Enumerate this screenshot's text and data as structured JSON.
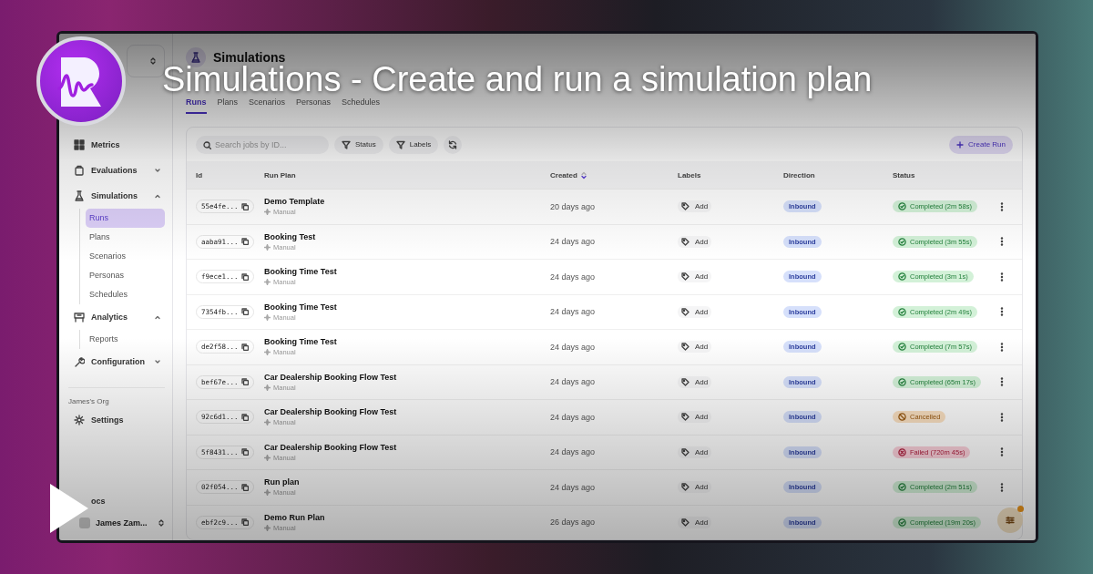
{
  "video_overlay": {
    "title": "Simulations - Create and run a simulation plan"
  },
  "sidebar": {
    "nav": [
      {
        "label": "Metrics"
      },
      {
        "label": "Evaluations",
        "expanded": false
      },
      {
        "label": "Simulations",
        "expanded": true,
        "children": [
          {
            "label": "Runs",
            "selected": true
          },
          {
            "label": "Plans",
            "selected": false
          },
          {
            "label": "Scenarios",
            "selected": false
          },
          {
            "label": "Personas",
            "selected": false
          },
          {
            "label": "Schedules",
            "selected": false
          }
        ]
      },
      {
        "label": "Analytics",
        "expanded": true,
        "children": [
          {
            "label": "Reports",
            "selected": false
          }
        ]
      },
      {
        "label": "Configuration",
        "expanded": false
      }
    ],
    "org": {
      "label": "James's Org",
      "items": [
        {
          "label": "Settings"
        }
      ]
    },
    "docs": "ocs",
    "user": "James Zam..."
  },
  "page": {
    "title": "Simulations",
    "tabs": [
      {
        "label": "Runs",
        "selected": true
      },
      {
        "label": "Plans",
        "selected": false
      },
      {
        "label": "Scenarios",
        "selected": false
      },
      {
        "label": "Personas",
        "selected": false
      },
      {
        "label": "Schedules",
        "selected": false
      }
    ]
  },
  "toolbar": {
    "search": {
      "placeholder": "Search jobs by ID..."
    },
    "filters": [
      "Status",
      "Labels"
    ],
    "create_button": "Create Run"
  },
  "table": {
    "columns": [
      {
        "label": "Id",
        "sorted": false
      },
      {
        "label": "Run Plan",
        "sorted": false
      },
      {
        "label": "Created",
        "sorted": true
      },
      {
        "label": "Labels",
        "sorted": false
      },
      {
        "label": "Direction",
        "sorted": false
      },
      {
        "label": "Status",
        "sorted": false
      }
    ],
    "rows": [
      {
        "id": "55e4fe...",
        "plan": "Demo Template",
        "trigger": "Manual",
        "created": "20 days ago",
        "labels": "Add",
        "direction": "Inbound",
        "status": {
          "kind": "completed",
          "text": "Completed (2m 58s)"
        }
      },
      {
        "id": "aaba91...",
        "plan": "Booking Test",
        "trigger": "Manual",
        "created": "24 days ago",
        "labels": "Add",
        "direction": "Inbound",
        "status": {
          "kind": "completed",
          "text": "Completed (3m 55s)"
        }
      },
      {
        "id": "f9ece1...",
        "plan": "Booking Time Test",
        "trigger": "Manual",
        "created": "24 days ago",
        "labels": "Add",
        "direction": "Inbound",
        "status": {
          "kind": "completed",
          "text": "Completed (3m 1s)"
        }
      },
      {
        "id": "7354fb...",
        "plan": "Booking Time Test",
        "trigger": "Manual",
        "created": "24 days ago",
        "labels": "Add",
        "direction": "Inbound",
        "status": {
          "kind": "completed",
          "text": "Completed (2m 49s)"
        }
      },
      {
        "id": "de2f58...",
        "plan": "Booking Time Test",
        "trigger": "Manual",
        "created": "24 days ago",
        "labels": "Add",
        "direction": "Inbound",
        "status": {
          "kind": "completed",
          "text": "Completed (7m 57s)"
        }
      },
      {
        "id": "bef67e...",
        "plan": "Car Dealership Booking Flow Test",
        "trigger": "Manual",
        "created": "24 days ago",
        "labels": "Add",
        "direction": "Inbound",
        "status": {
          "kind": "completed",
          "text": "Completed (65m 17s)"
        }
      },
      {
        "id": "92c6d1...",
        "plan": "Car Dealership Booking Flow Test",
        "trigger": "Manual",
        "created": "24 days ago",
        "labels": "Add",
        "direction": "Inbound",
        "status": {
          "kind": "cancelled",
          "text": "Cancelled"
        }
      },
      {
        "id": "5f8431...",
        "plan": "Car Dealership Booking Flow Test",
        "trigger": "Manual",
        "created": "24 days ago",
        "labels": "Add",
        "direction": "Inbound",
        "status": {
          "kind": "failed",
          "text": "Failed (720m 45s)"
        }
      },
      {
        "id": "02f054...",
        "plan": "Run plan",
        "trigger": "Manual",
        "created": "24 days ago",
        "labels": "Add",
        "direction": "Inbound",
        "status": {
          "kind": "completed",
          "text": "Completed (2m 51s)"
        }
      },
      {
        "id": "ebf2c9...",
        "plan": "Demo Run Plan",
        "trigger": "Manual",
        "created": "26 days ago",
        "labels": "Add",
        "direction": "Inbound",
        "status": {
          "kind": "completed",
          "text": "Completed (19m 20s)"
        }
      }
    ]
  }
}
